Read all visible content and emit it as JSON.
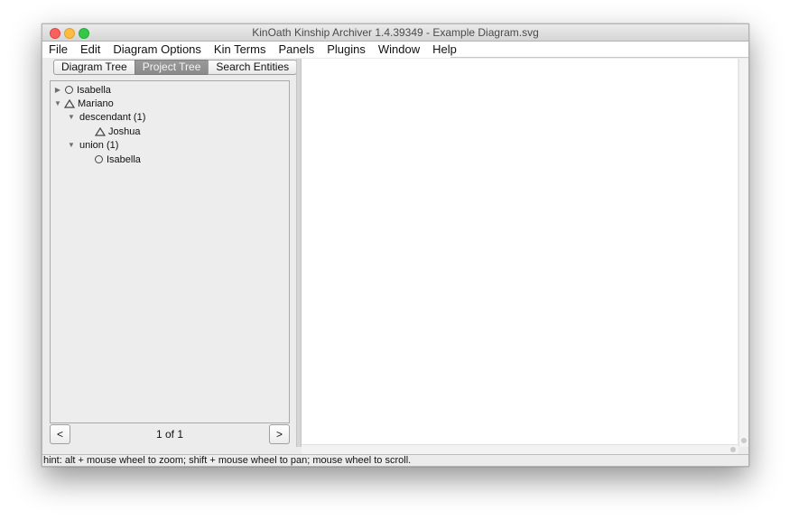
{
  "window": {
    "title": "KinOath Kinship Archiver 1.4.39349 - Example Diagram.svg"
  },
  "menubar": {
    "items": [
      "File",
      "Edit",
      "Diagram Options",
      "Kin Terms",
      "Panels",
      "Plugins",
      "Window",
      "Help"
    ]
  },
  "tabs": [
    {
      "label": "Diagram Tree",
      "active": false
    },
    {
      "label": "Project Tree",
      "active": true
    },
    {
      "label": "Search Entities",
      "active": false
    }
  ],
  "tree": {
    "nodes": [
      {
        "label": "Isabella",
        "icon": "circle-icon",
        "expanded": false
      },
      {
        "label": "Mariano",
        "icon": "triangle-icon",
        "expanded": true
      },
      {
        "label": "descendant (1)",
        "icon": "",
        "expanded": true
      },
      {
        "label": "Joshua",
        "icon": "triangle-icon"
      },
      {
        "label": "union (1)",
        "icon": "",
        "expanded": true
      },
      {
        "label": "Isabella",
        "icon": "circle-icon"
      }
    ]
  },
  "pager": {
    "prev_label": "<",
    "next_label": ">",
    "indicator": "1 of 1"
  },
  "status": {
    "hint": "hint: alt + mouse wheel to zoom; shift + mouse wheel to pan; mouse wheel to scroll."
  }
}
